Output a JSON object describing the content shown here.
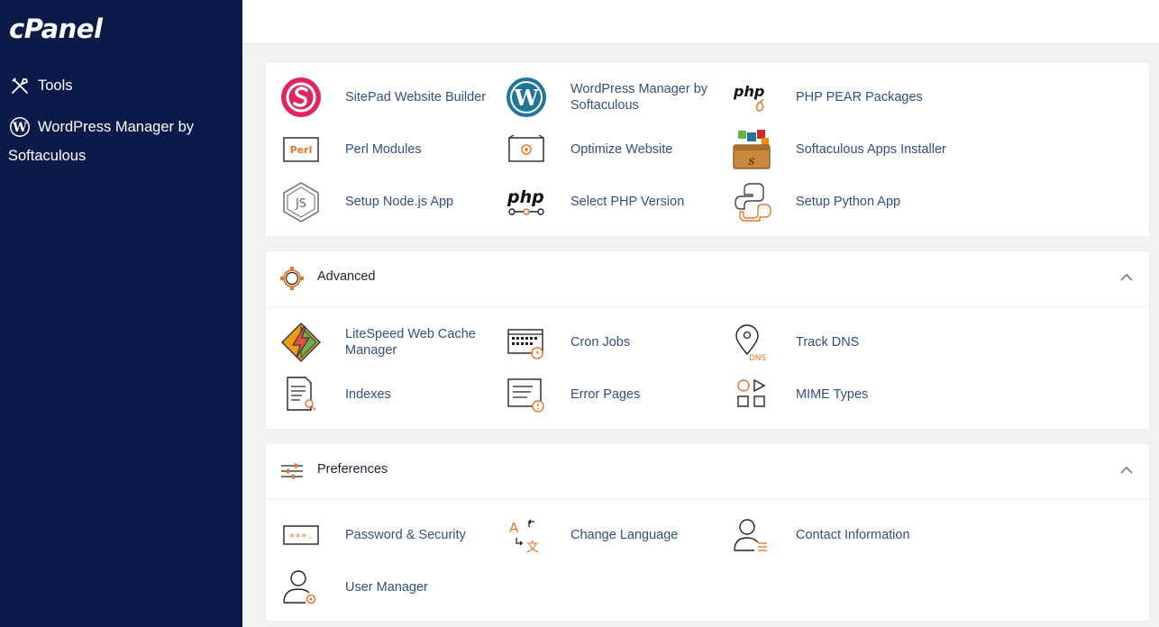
{
  "sidebar": {
    "logo": "cPanel",
    "tools_label": "Tools",
    "wp_label_line1": "WordPress Manager by",
    "wp_label_line2": "Softaculous"
  },
  "software": {
    "items": [
      {
        "label": "SitePad Website Builder"
      },
      {
        "label": "WordPress Manager by Softaculous"
      },
      {
        "label": "PHP PEAR Packages"
      },
      {
        "label": "Perl Modules"
      },
      {
        "label": "Optimize Website"
      },
      {
        "label": "Softaculous Apps Installer"
      },
      {
        "label": "Setup Node.js App"
      },
      {
        "label": "Select PHP Version"
      },
      {
        "label": "Setup Python App"
      }
    ]
  },
  "advanced": {
    "title": "Advanced",
    "items": [
      {
        "label": "LiteSpeed Web Cache Manager"
      },
      {
        "label": "Cron Jobs"
      },
      {
        "label": "Track DNS"
      },
      {
        "label": "Indexes"
      },
      {
        "label": "Error Pages"
      },
      {
        "label": "MIME Types"
      }
    ]
  },
  "preferences": {
    "title": "Preferences",
    "items": [
      {
        "label": "Password & Security"
      },
      {
        "label": "Change Language"
      },
      {
        "label": "Contact Information"
      },
      {
        "label": "User Manager"
      }
    ]
  },
  "icon_text": {
    "php": "php",
    "perl": "Perl",
    "js": "JS",
    "dns": "DNS",
    "lang_a": "A",
    "lang_zh": "文",
    "pw_dots": "***-"
  },
  "colors": {
    "sidebar_bg": "#0b1a48",
    "accent_orange": "#e8772e",
    "link_blue": "#315080",
    "sitepad_red": "#e0245e",
    "wordpress_blue": "#21759b"
  }
}
